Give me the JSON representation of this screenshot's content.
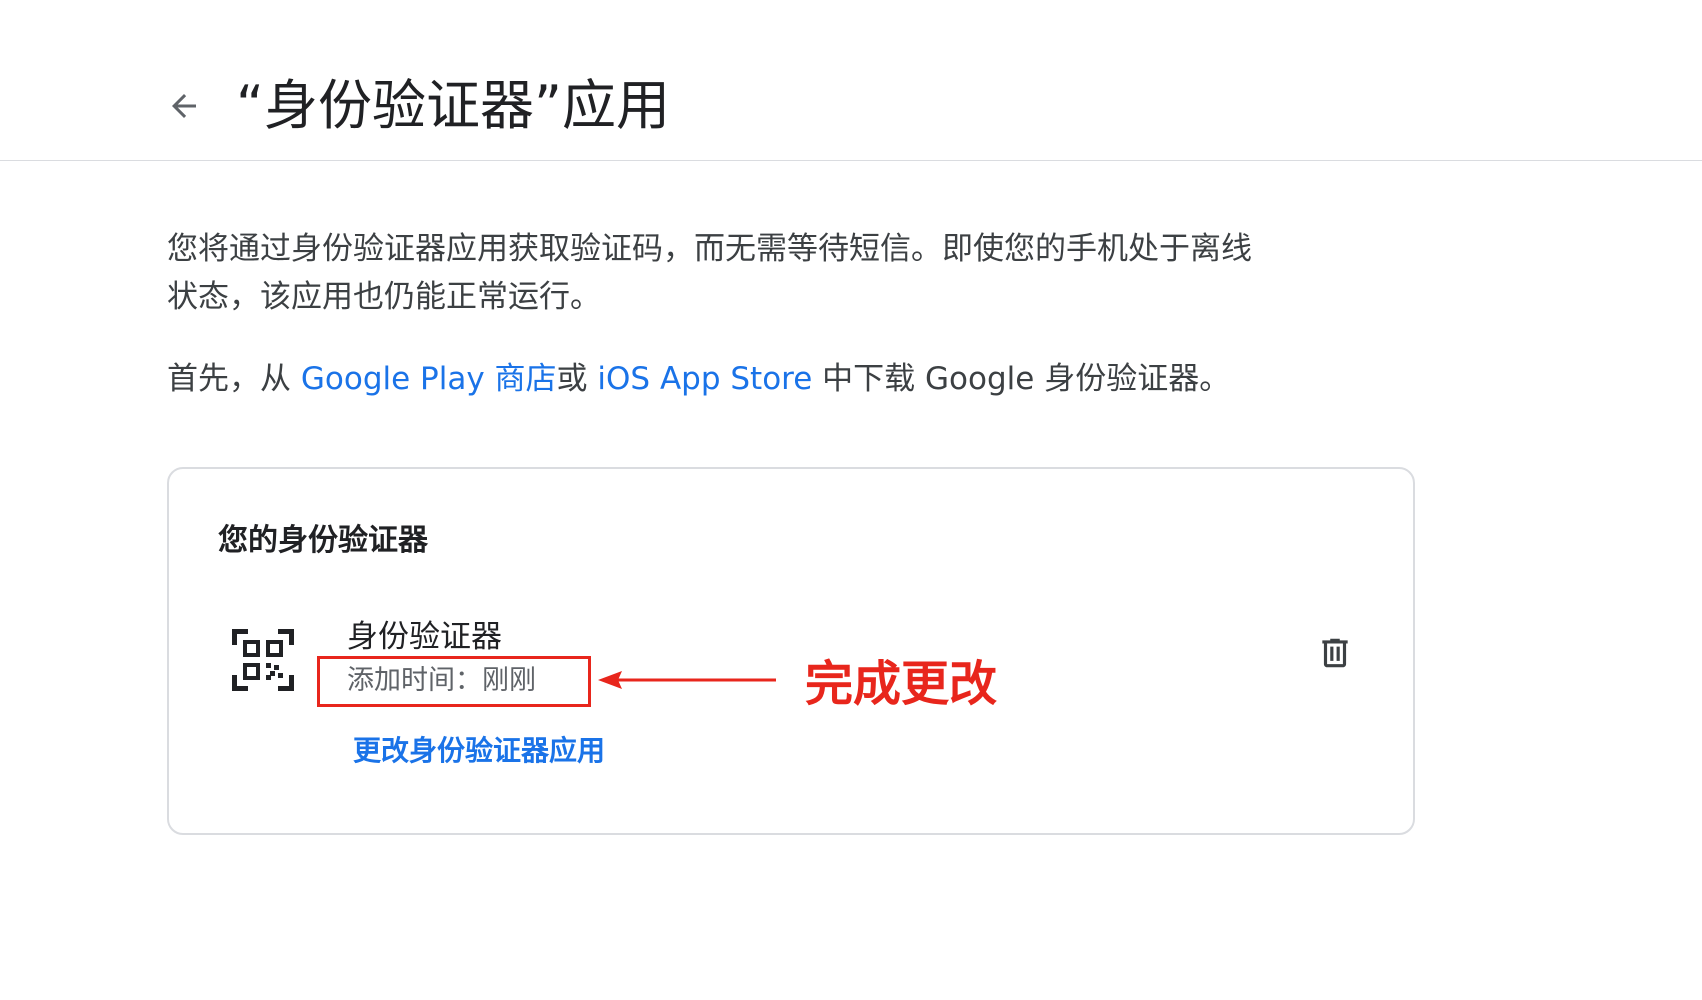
{
  "header": {
    "back_icon": "arrow-left-icon",
    "title": "“身份验证器”应用"
  },
  "main": {
    "description": "您将通过身份验证器应用获取验证码，而无需等待短信。即使您的手机处于离线状态，该应用也仍能正常运行。",
    "download": {
      "prefix": "首先，从 ",
      "play_store_link": "Google Play 商店",
      "middle": "或 ",
      "app_store_link": "iOS App Store",
      "suffix": " 中下载 Google 身份验证器。"
    },
    "card": {
      "title": "您的身份验证器",
      "item": {
        "icon": "qr-code-icon",
        "name": "身份验证器",
        "added_time": "添加时间：刚刚",
        "delete_icon": "trash-icon"
      },
      "change_link": "更改身份验证器应用"
    }
  },
  "annotation": {
    "label": "完成更改",
    "color": "#e8261c"
  },
  "colors": {
    "link": "#1a73e8",
    "text_primary": "#202124",
    "text_secondary": "#5f6368",
    "border": "#dadce0"
  }
}
